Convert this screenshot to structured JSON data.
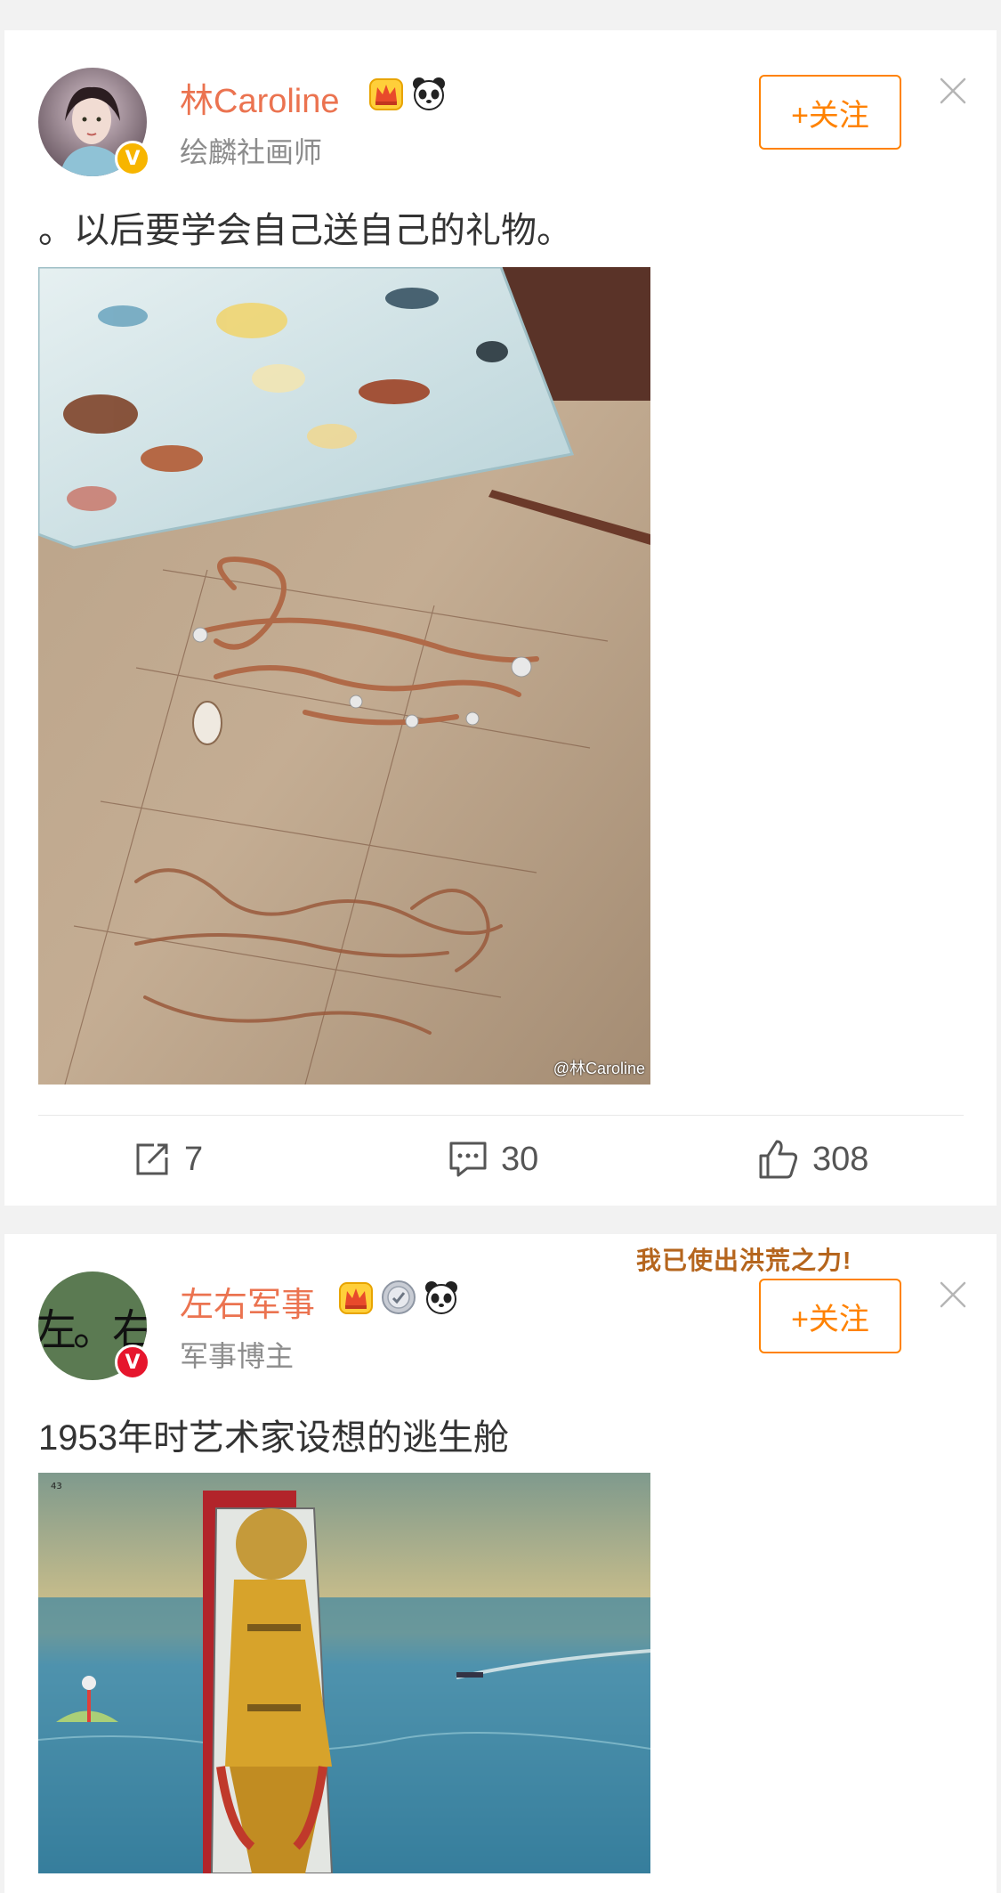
{
  "feed": [
    {
      "user": {
        "name": "林Caroline",
        "subtitle": "绘麟社画师",
        "verified_color": "#f7b500",
        "badges": [
          "crown-badge-icon",
          "panda-badge-icon"
        ]
      },
      "follow_label": "+关注",
      "text": "。以后要学会自己送自己的礼物。",
      "image": {
        "description_icon": "palette-illustration",
        "watermark": "@林Caroline"
      },
      "actions": {
        "repost_count": "7",
        "comment_count": "30",
        "like_count": "308"
      }
    },
    {
      "user": {
        "name": "左右军事",
        "subtitle": "军事博主",
        "verified_color": "#e6162d",
        "avatar_text": "左。右",
        "badges": [
          "crown-badge-icon",
          "medal-badge-icon",
          "panda-badge-icon"
        ]
      },
      "sticker_text": "我已使出洪荒之力!",
      "follow_label": "+关注",
      "text": "1953年时艺术家设想的逃生舱"
    }
  ],
  "colors": {
    "accent_orange": "#ff8200",
    "username": "#eb7350"
  }
}
